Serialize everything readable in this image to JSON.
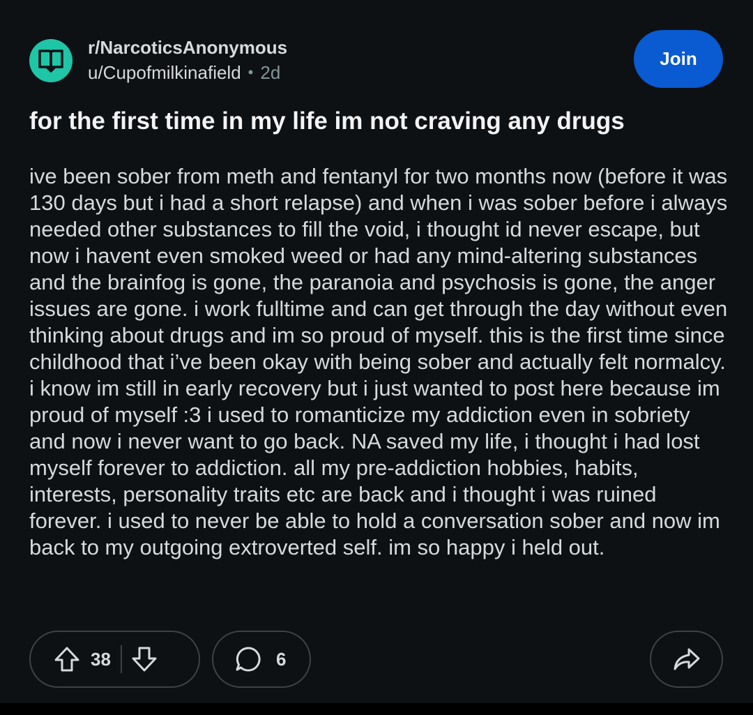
{
  "header": {
    "subreddit": "r/NarcoticsAnonymous",
    "username": "u/Cupofmilkinafield",
    "separator": "•",
    "age": "2d",
    "avatar_icon": "open-book-icon",
    "avatar_color": "#1fc5a7"
  },
  "join_button": {
    "label": "Join",
    "color": "#0a5ad1"
  },
  "post": {
    "title": "for the first time in my life im not craving any drugs",
    "body": "ive been sober from meth and fentanyl for two months now (before it was 130 days but i had a short relapse) and when i was sober before i always needed other substances to fill the void, i thought id never escape, but now i havent even smoked weed or had any mind-altering substances and the brainfog is gone, the paranoia and psychosis is gone, the anger issues are gone. i work fulltime and can get through the day without even thinking about drugs and im so proud of myself. this is the first time since childhood that i’ve been okay with being sober and actually felt normalcy. i know im still in early recovery but i just wanted to post here because im proud of myself :3 i used to romanticize my addiction even in sobriety and now i never want to go back. NA saved my life, i thought i had lost myself forever to addiction. all my pre-addiction hobbies, habits, interests, personality traits etc are back and i thought i was ruined forever. i used to never be able to hold a conversation sober and now im back to my outgoing extroverted self. im so happy i held out."
  },
  "actions": {
    "upvote_icon": "arrow-up-icon",
    "vote_count": "38",
    "downvote_icon": "arrow-down-icon",
    "comment_icon": "comment-bubble-icon",
    "comment_count": "6",
    "share_icon": "share-arrow-icon"
  },
  "colors": {
    "background": "#0e1113",
    "text": "#d7dadc",
    "muted": "#82959b",
    "border": "#3e4246"
  }
}
